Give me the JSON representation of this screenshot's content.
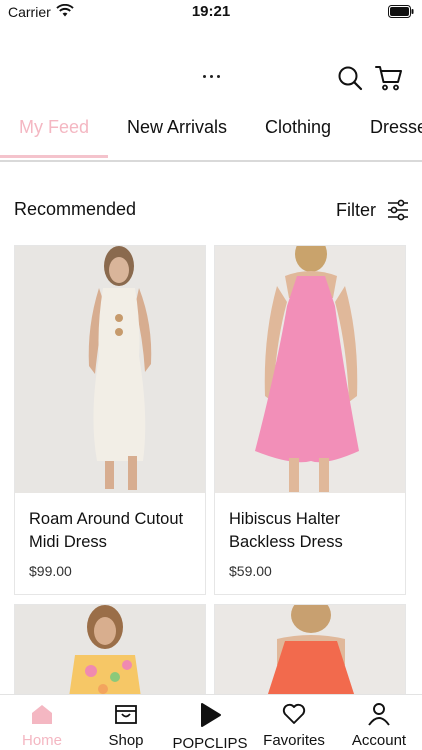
{
  "status_bar": {
    "carrier": "Carrier",
    "time": "19:21"
  },
  "tabs": [
    {
      "label": "My Feed",
      "active": true
    },
    {
      "label": "New Arrivals",
      "active": false
    },
    {
      "label": "Clothing",
      "active": false
    },
    {
      "label": "Dresse",
      "active": false
    }
  ],
  "section": {
    "title": "Recommended",
    "filter_label": "Filter"
  },
  "products": [
    {
      "name": "Roam Around Cutout Midi Dress",
      "price": "$99.00",
      "dress_color": "#f2eee6"
    },
    {
      "name": "Hibiscus Halter Backless Dress",
      "price": "$59.00",
      "dress_color": "#f28fb8"
    }
  ],
  "bottom_nav": [
    {
      "label": "Home",
      "icon": "home-icon",
      "active": true
    },
    {
      "label": "Shop",
      "icon": "shop-icon",
      "active": false
    },
    {
      "label": "POPCLIPS",
      "icon": "play-icon",
      "active": false
    },
    {
      "label": "Favorites",
      "icon": "heart-icon",
      "active": false
    },
    {
      "label": "Account",
      "icon": "person-icon",
      "active": false
    }
  ],
  "colors": {
    "accent": "#f4b7c2",
    "divider": "#d9d9d9"
  }
}
